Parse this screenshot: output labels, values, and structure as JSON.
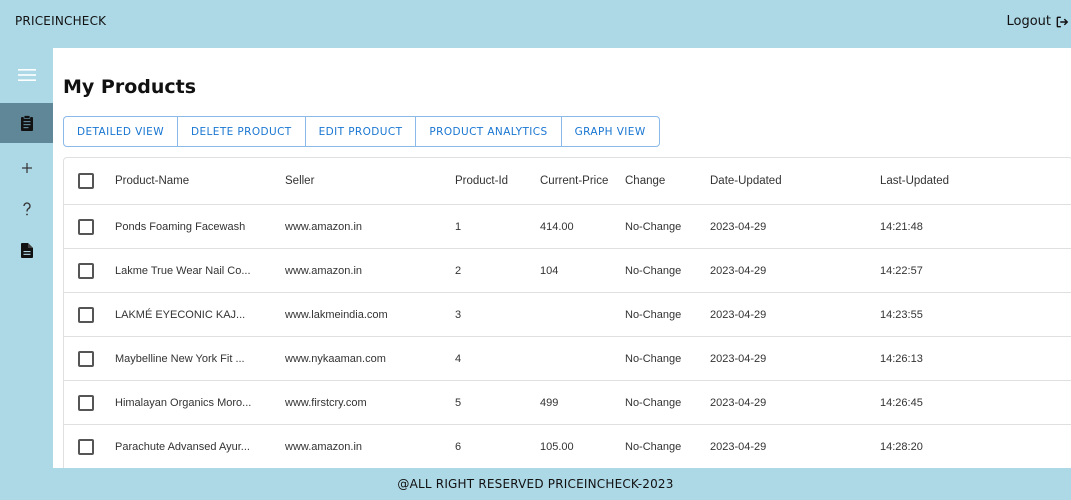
{
  "app": {
    "title": "PRICEINCHECK",
    "logout_label": "Logout"
  },
  "sidebar": {
    "items": [
      {
        "icon": "menu-icon"
      },
      {
        "icon": "clipboard-icon",
        "active": true
      },
      {
        "icon": "plus-icon"
      },
      {
        "icon": "help-icon"
      },
      {
        "icon": "file-icon"
      }
    ]
  },
  "page": {
    "title": "My Products"
  },
  "toolbar": {
    "detailed_view": "DETAILED VIEW",
    "delete_product": "DELETE PRODUCT",
    "edit_product": "EDIT PRODUCT",
    "product_analytics": "PRODUCT ANALYTICS",
    "graph_view": "GRAPH VIEW"
  },
  "table": {
    "columns": {
      "name": "Product-Name",
      "seller": "Seller",
      "id": "Product-Id",
      "price": "Current-Price",
      "change": "Change",
      "date": "Date-Updated",
      "time": "Last-Updated"
    },
    "rows": [
      {
        "name": "Ponds Foaming Facewash",
        "seller": "www.amazon.in",
        "id": "1",
        "price": "414.00",
        "change": "No-Change",
        "date": "2023-04-29",
        "time": "14:21:48"
      },
      {
        "name": "Lakme True Wear Nail Co...",
        "seller": "www.amazon.in",
        "id": "2",
        "price": "104",
        "change": "No-Change",
        "date": "2023-04-29",
        "time": "14:22:57"
      },
      {
        "name": "LAKMÉ EYECONIC KAJ...",
        "seller": "www.lakmeindia.com",
        "id": "3",
        "price": "",
        "change": "No-Change",
        "date": "2023-04-29",
        "time": "14:23:55"
      },
      {
        "name": "Maybelline New York Fit ...",
        "seller": "www.nykaaman.com",
        "id": "4",
        "price": "",
        "change": "No-Change",
        "date": "2023-04-29",
        "time": "14:26:13"
      },
      {
        "name": "Himalayan Organics Moro...",
        "seller": "www.firstcry.com",
        "id": "5",
        "price": "499",
        "change": "No-Change",
        "date": "2023-04-29",
        "time": "14:26:45"
      },
      {
        "name": "Parachute Advansed Ayur...",
        "seller": "www.amazon.in",
        "id": "6",
        "price": "105.00",
        "change": "No-Change",
        "date": "2023-04-29",
        "time": "14:28:20"
      }
    ]
  },
  "footer": {
    "text": "@ALL RIGHT RESERVED PRICEINCHECK-2023"
  },
  "colors": {
    "background": "#add8e6",
    "sidebar_active": "#5f8797",
    "accent": "#1976d2"
  }
}
